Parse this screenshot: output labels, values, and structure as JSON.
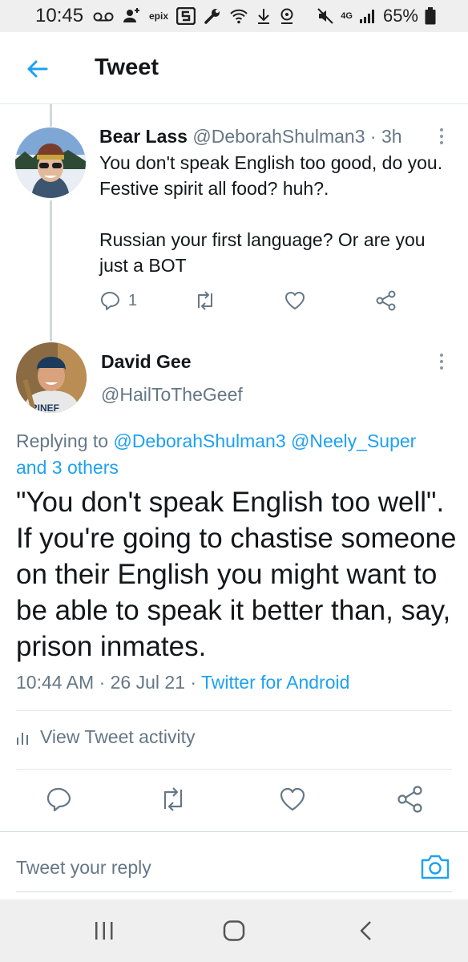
{
  "status_bar": {
    "time": "10:45",
    "battery_percent": "65%",
    "epix_label": "epix",
    "network_label": "4G",
    "icons": [
      "voicemail-icon",
      "add-person-icon",
      "epix-icon",
      "s-app-icon",
      "wrench-icon",
      "wifi-icon",
      "download-icon",
      "location-icon",
      "mute-icon",
      "4g-icon",
      "signal-icon",
      "battery-icon"
    ]
  },
  "header": {
    "title": "Tweet",
    "back_icon": "back-arrow-icon"
  },
  "parent_tweet": {
    "name": "Bear Lass",
    "handle": "@DeborahShulman3",
    "separator": " · ",
    "time": "3h",
    "body": "You don't speak English too good, do you.  Festive spirit all food?  huh?.\n\nRussian your first language?  Or are you just a BOT",
    "reply_count": "1"
  },
  "main_tweet": {
    "name": "David Gee",
    "handle": "@HailToTheGeef",
    "replying_prefix": "Replying to ",
    "mention_1": "@DeborahShulman3",
    "mention_2": "@Neely_Super",
    "and_others": "and 3 others",
    "body": "\"You don't speak English too well\". If you're going to chastise someone on their English you might want to be able to speak it better than, say, prison inmates.",
    "time": "10:44 AM",
    "sep": " · ",
    "date": "26 Jul 21",
    "source": "Twitter for Android",
    "activity_label": "View Tweet activity"
  },
  "reply_bar": {
    "placeholder": "Tweet your reply"
  },
  "colors": {
    "accent": "#1da1f2",
    "text": "#14171a",
    "secondary": "#657786",
    "divider": "#e1e8ed"
  }
}
